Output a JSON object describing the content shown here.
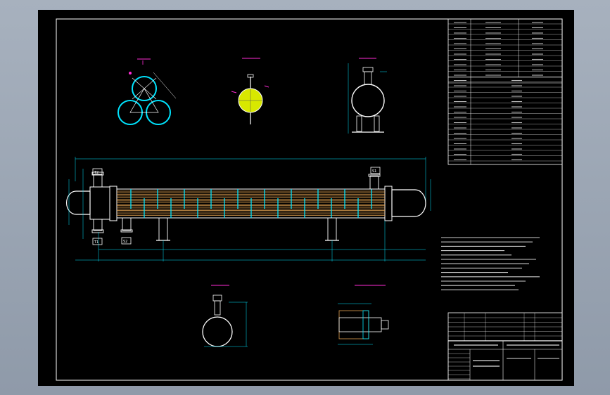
{
  "drawing": {
    "background": "#000000",
    "frame_color": "#ffffff",
    "accent_colors": {
      "outline": "#ffffff",
      "cyan": "#00e5ff",
      "yellow": "#ffff00",
      "magenta": "#ff2bd6",
      "tubes": "#e0a050",
      "spec_fill": "#d8e800"
    }
  },
  "nozzle_labels": {
    "t2": "T2",
    "t1": "T1",
    "s1": "S1",
    "s2": "S2"
  },
  "nozzle_tags": {
    "t2_num": "1",
    "s2_num": "2"
  }
}
